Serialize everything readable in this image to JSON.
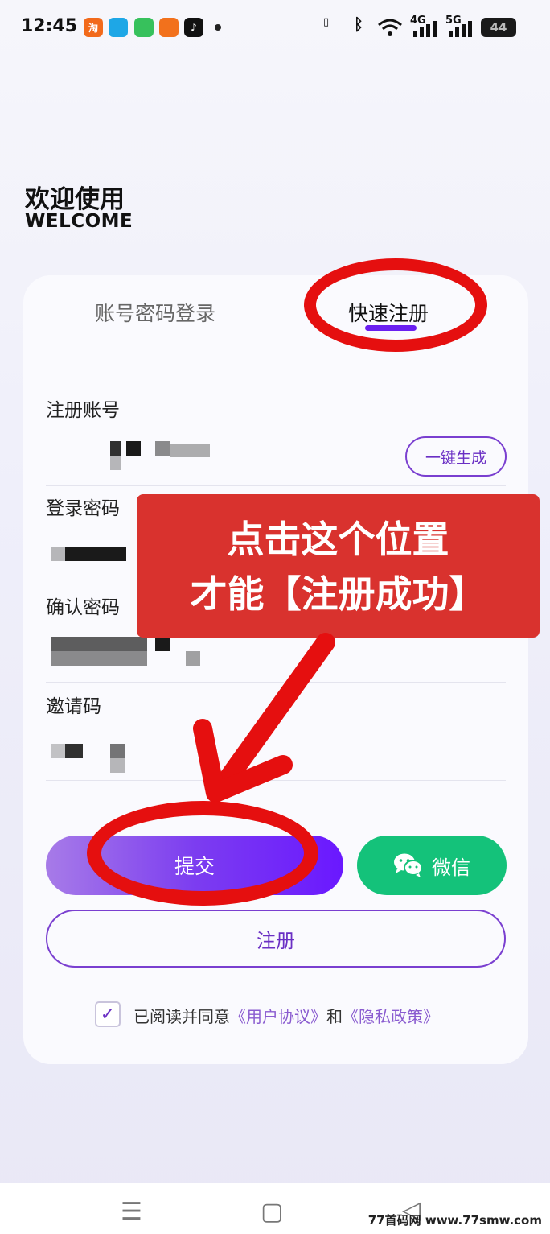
{
  "status_bar": {
    "time": "12:45",
    "apps": [
      {
        "name": "taobao-icon",
        "glyph": "淘",
        "color": "#f26a1b"
      },
      {
        "name": "qq-icon",
        "glyph": "",
        "color": "#1ea7e6"
      },
      {
        "name": "green-app-icon",
        "glyph": "",
        "color": "#37c15c"
      },
      {
        "name": "orange-app-icon",
        "glyph": "",
        "color": "#f2711c"
      },
      {
        "name": "tiktok-icon",
        "glyph": "♪",
        "color": "#111111"
      }
    ],
    "signal_4g": "4G",
    "signal_5g": "5G",
    "battery": "44"
  },
  "welcome": {
    "title": "欢迎使用",
    "subtitle": "WELCOME"
  },
  "tabs": {
    "login": "账号密码登录",
    "register": "快速注册"
  },
  "form": {
    "account_label": "注册账号",
    "generate_button": "一键生成",
    "password_label": "登录密码",
    "confirm_label": "确认密码",
    "invite_label": "邀请码"
  },
  "buttons": {
    "submit": "提交",
    "wechat": "微信",
    "register": "注册"
  },
  "agreement": {
    "prefix": "已阅读并同意",
    "user_agreement": "《用户协议》",
    "and": "和",
    "privacy_policy": "《隐私政策》",
    "checked": true
  },
  "annotation": {
    "line1": "点击这个位置",
    "line2": "才能【注册成功】"
  },
  "watermark": "77首码网 www.77smw.com",
  "colors": {
    "accent": "#6a1ff0",
    "wechat": "#14c27a",
    "annotation_red": "#e50f0f",
    "callout": "#d9322e"
  }
}
